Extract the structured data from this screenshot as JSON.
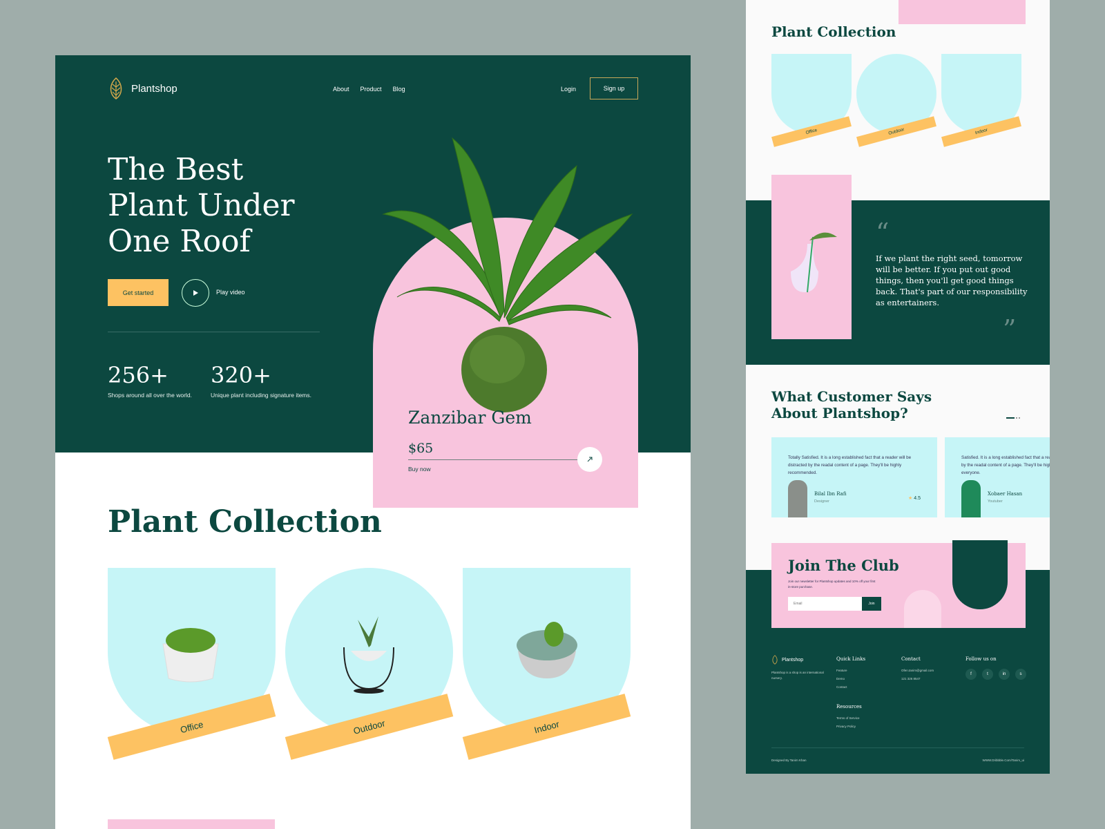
{
  "colors": {
    "brand_green": "#0c4840",
    "pink": "#f8c4dd",
    "mint": "#c6f5f7",
    "yellow": "#fdc262",
    "background": "#9fadaa"
  },
  "header": {
    "brand": "Plantshop",
    "nav": [
      "About",
      "Product",
      "Blog"
    ],
    "login": "Login",
    "signup": "Sign up"
  },
  "hero": {
    "title": "The Best Plant Under One Roof",
    "cta_primary": "Get started",
    "cta_secondary": "Play video",
    "stats": [
      {
        "value": "256+",
        "label": "Shops around all over the world."
      },
      {
        "value": "320+",
        "label": "Unique plant including signature items."
      }
    ]
  },
  "featured_product": {
    "name": "Zanzibar Gem",
    "price": "$65",
    "action": "Buy now"
  },
  "collection": {
    "title": "Plant Collection",
    "categories": [
      "Office",
      "Outdoor",
      "Indoor"
    ]
  },
  "quote": {
    "text": "If we plant the right seed, tomorrow will be better. If you put out good things, then you'll get good things back. That's part of our responsibility as entertainers."
  },
  "testimonials": {
    "title": "What Customer Says About Plantshop?",
    "items": [
      {
        "text": "Totally Satisfied. It is a long established fact that a reader will be distracted by the readal content of a page. They'll be highly recommended.",
        "name": "Bilal Ibn Rafi",
        "role": "Designer",
        "rating": "4.5"
      },
      {
        "text": "Satisfied. It is a long established fact that a reader will be distracted by the readal content of a page. They'll be highly recommended to everyone.",
        "name": "Xobaer Hasan",
        "role": "Youtuber"
      }
    ]
  },
  "club": {
    "title": "Join The Club",
    "subtitle": "Join our newsletter for Plantshop updates and 10% off your first in-store purchase.",
    "email_placeholder": "Email",
    "join_label": "Join"
  },
  "footer": {
    "brand": "Plantshop",
    "description": "Plantshop is a shop is an international nursery.",
    "quick_links": {
      "title": "Quick Links",
      "items": [
        "Feature",
        "Demo",
        "Contact"
      ]
    },
    "resources": {
      "title": "Resources",
      "items": [
        "Terms of Service",
        "Privacy Policy"
      ]
    },
    "contact": {
      "title": "Contact",
      "email": "Ofen.tanim@gmail.com",
      "phone": "121 326 8547"
    },
    "follow": {
      "title": "Follow us on",
      "icons": [
        "facebook",
        "twitter",
        "linkedin",
        "skype"
      ]
    },
    "designed_by": "Designed By Tanim Khan",
    "site": "WWW.Dribbble.Com/Tanim_ui"
  }
}
